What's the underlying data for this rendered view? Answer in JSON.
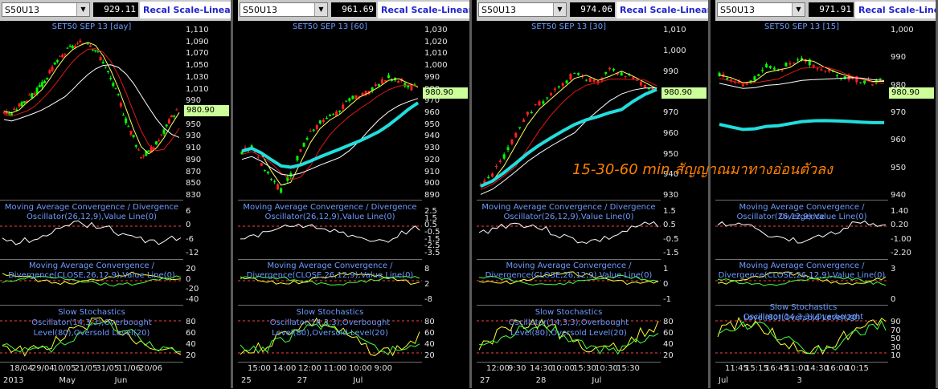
{
  "annotation": "15-30-60 min สัญญาณมาทางอ่อนตัวลง",
  "common": {
    "macd_title": "Moving Average Convergence / Divergence",
    "macd_sub": "Oscillator(26,12,9),Value Line(0)",
    "stoch_title": "Slow Stochastics",
    "stoch_sub1": "Oscillator(14,3,3),Overbought",
    "stoch_sub2": "Level(80),Oversold Level(20)",
    "recal": "Recal Scale-Linear",
    "last_price": "980.90"
  },
  "colors": {
    "up": "#00ff00",
    "down": "#ff2020",
    "ma_fast": "#ffff66",
    "ma_mid": "#e01818",
    "ma_slow": "#ffffff",
    "cyan": "#22dddd",
    "accent": "#6e9bff"
  },
  "panels": [
    {
      "symbol": "S50U13",
      "price": "929.11",
      "title": "SET50 SEP 13   [day]",
      "y_ticks": [
        "1,110",
        "1,090",
        "1,070",
        "1,050",
        "1,030",
        "1,010",
        "990",
        "970",
        "950",
        "930",
        "910",
        "890",
        "870",
        "850",
        "830"
      ],
      "macd_ticks": [
        "6",
        "0",
        "-6",
        "-12"
      ],
      "macd2_title": "Moving Average Convergence /",
      "macd2_sub": "Divergence(CLOSE,26,12,9),Value Line(0)",
      "macd2_ticks": [
        "20",
        "0",
        "-20",
        "-40"
      ],
      "stoch_ticks": [
        "80",
        "60",
        "40",
        "20"
      ],
      "x_top": [
        "18/04",
        "29/04",
        "10/05",
        "21/05",
        "31/05",
        "11/06",
        "20/06"
      ],
      "x_bottom": [
        "2013",
        "May",
        "Jun"
      ]
    },
    {
      "symbol": "S50U13",
      "price": "961.69",
      "title": "SET50 SEP 13   [60]",
      "y_ticks": [
        "1,030",
        "1,020",
        "1,010",
        "1,000",
        "990",
        "980",
        "970",
        "960",
        "950",
        "940",
        "930",
        "920",
        "910",
        "900",
        "890"
      ],
      "macd_ticks": [
        "2.5",
        "1.5",
        "0.5",
        "-0.5",
        "-1.5",
        "-2.5",
        "-3.5"
      ],
      "macd2_title": "Moving Average Convergence /",
      "macd2_sub": "Divergence(CLOSE,26,12,9),Value Line(0)",
      "macd2_ticks": [
        "8",
        "2",
        "-8"
      ],
      "stoch_ticks": [
        "80",
        "60",
        "40",
        "20"
      ],
      "x_top": [
        "15:00",
        "14:00",
        "12:00",
        "11:00",
        "10:00",
        "9:00"
      ],
      "x_bottom": [
        "25",
        "27",
        "Jul"
      ]
    },
    {
      "symbol": "S50U13",
      "price": "974.06",
      "title": "SET50 SEP 13   [30]",
      "y_ticks": [
        "1,010",
        "1,000",
        "990",
        "980",
        "970",
        "960",
        "950",
        "940",
        "930"
      ],
      "macd_ticks": [
        "1.5",
        "0.5",
        "-0.5",
        "-1.5"
      ],
      "macd2_title": "Moving Average Convergence /",
      "macd2_sub": "Divergence(CLOSE,26,12,9),Value Line(0)",
      "macd2_ticks": [
        "1",
        "0",
        "-1"
      ],
      "stoch_ticks": [
        "80",
        "60",
        "40",
        "20"
      ],
      "x_top": [
        "12:00",
        "9:30",
        "14:30",
        "10:00",
        "15:30",
        "10:30",
        "15:30"
      ],
      "x_bottom": [
        "27",
        "28",
        "Jul"
      ]
    },
    {
      "symbol": "S50U13",
      "price": "971.91",
      "title": "SET50 SEP 13   [15]",
      "y_ticks": [
        "1,000",
        "990",
        "980",
        "970",
        "960",
        "950",
        "940"
      ],
      "macd_ticks": [
        "1.40",
        "0.20",
        "-1.00",
        "-2.20"
      ],
      "macd2_title": "Moving Average Convergence /",
      "macd2_sub": "Divergence(CLOSE,26,12,9),Value Line(0)",
      "macd2_ticks": [
        "3",
        "0"
      ],
      "stoch_title_inline": "Slow Stochastics Oscillator(14,3,3),Overbought",
      "stoch_sub_inline": "Level(80),Oversold Level(20)",
      "stoch_ticks": [
        "90",
        "70",
        "50",
        "30",
        "10"
      ],
      "x_top": [
        "11:45",
        "15:15",
        "16:45",
        "11:00",
        "14:30",
        "16:00",
        "10:15"
      ],
      "x_bottom": [
        "Jul",
        "3"
      ]
    }
  ],
  "chart_data": [
    {
      "type": "line",
      "title": "SET50 SEP 13 [day]",
      "last": 980.9,
      "ylim": [
        830,
        1110
      ],
      "series": [
        {
          "name": "close",
          "values": [
            975,
            970,
            985,
            995,
            1005,
            1020,
            1040,
            1060,
            1075,
            1085,
            1090,
            1095,
            1080,
            1060,
            1030,
            1000,
            960,
            930,
            900,
            905,
            920,
            940,
            965,
            981
          ]
        }
      ]
    },
    {
      "type": "line",
      "title": "SET50 SEP 13 [60]",
      "last": 980.9,
      "ylim": [
        885,
        1030
      ],
      "series": [
        {
          "name": "close",
          "values": [
            925,
            930,
            915,
            900,
            890,
            905,
            925,
            940,
            950,
            955,
            960,
            970,
            975,
            978,
            985,
            990,
            988,
            982,
            981
          ]
        }
      ]
    },
    {
      "type": "line",
      "title": "SET50 SEP 13 [30]",
      "last": 980.9,
      "ylim": [
        930,
        1010
      ],
      "series": [
        {
          "name": "close",
          "values": [
            935,
            940,
            950,
            960,
            970,
            975,
            980,
            985,
            990,
            988,
            985,
            992,
            990,
            987,
            984,
            981
          ]
        }
      ]
    },
    {
      "type": "line",
      "title": "SET50 SEP 13 [15]",
      "last": 980.9,
      "ylim": [
        935,
        1000
      ],
      "series": [
        {
          "name": "close",
          "values": [
            983,
            981,
            979,
            982,
            986,
            984,
            988,
            990,
            987,
            985,
            983,
            982,
            981,
            980,
            981
          ]
        }
      ]
    }
  ]
}
